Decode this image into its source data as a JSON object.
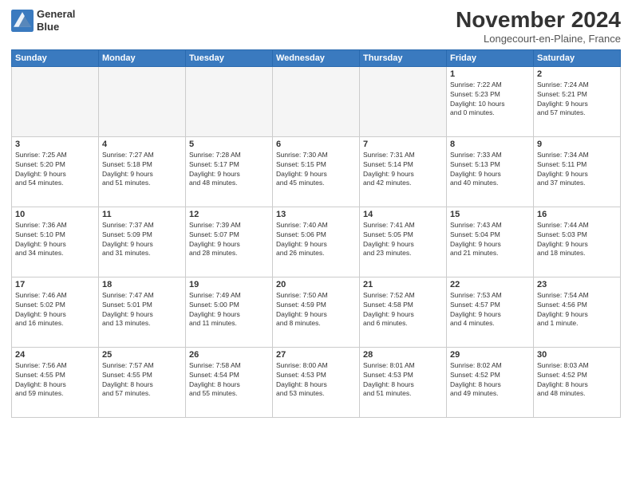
{
  "header": {
    "logo_line1": "General",
    "logo_line2": "Blue",
    "month_title": "November 2024",
    "location": "Longecourt-en-Plaine, France"
  },
  "weekdays": [
    "Sunday",
    "Monday",
    "Tuesday",
    "Wednesday",
    "Thursday",
    "Friday",
    "Saturday"
  ],
  "weeks": [
    [
      {
        "num": "",
        "info": ""
      },
      {
        "num": "",
        "info": ""
      },
      {
        "num": "",
        "info": ""
      },
      {
        "num": "",
        "info": ""
      },
      {
        "num": "",
        "info": ""
      },
      {
        "num": "1",
        "info": "Sunrise: 7:22 AM\nSunset: 5:23 PM\nDaylight: 10 hours\nand 0 minutes."
      },
      {
        "num": "2",
        "info": "Sunrise: 7:24 AM\nSunset: 5:21 PM\nDaylight: 9 hours\nand 57 minutes."
      }
    ],
    [
      {
        "num": "3",
        "info": "Sunrise: 7:25 AM\nSunset: 5:20 PM\nDaylight: 9 hours\nand 54 minutes."
      },
      {
        "num": "4",
        "info": "Sunrise: 7:27 AM\nSunset: 5:18 PM\nDaylight: 9 hours\nand 51 minutes."
      },
      {
        "num": "5",
        "info": "Sunrise: 7:28 AM\nSunset: 5:17 PM\nDaylight: 9 hours\nand 48 minutes."
      },
      {
        "num": "6",
        "info": "Sunrise: 7:30 AM\nSunset: 5:15 PM\nDaylight: 9 hours\nand 45 minutes."
      },
      {
        "num": "7",
        "info": "Sunrise: 7:31 AM\nSunset: 5:14 PM\nDaylight: 9 hours\nand 42 minutes."
      },
      {
        "num": "8",
        "info": "Sunrise: 7:33 AM\nSunset: 5:13 PM\nDaylight: 9 hours\nand 40 minutes."
      },
      {
        "num": "9",
        "info": "Sunrise: 7:34 AM\nSunset: 5:11 PM\nDaylight: 9 hours\nand 37 minutes."
      }
    ],
    [
      {
        "num": "10",
        "info": "Sunrise: 7:36 AM\nSunset: 5:10 PM\nDaylight: 9 hours\nand 34 minutes."
      },
      {
        "num": "11",
        "info": "Sunrise: 7:37 AM\nSunset: 5:09 PM\nDaylight: 9 hours\nand 31 minutes."
      },
      {
        "num": "12",
        "info": "Sunrise: 7:39 AM\nSunset: 5:07 PM\nDaylight: 9 hours\nand 28 minutes."
      },
      {
        "num": "13",
        "info": "Sunrise: 7:40 AM\nSunset: 5:06 PM\nDaylight: 9 hours\nand 26 minutes."
      },
      {
        "num": "14",
        "info": "Sunrise: 7:41 AM\nSunset: 5:05 PM\nDaylight: 9 hours\nand 23 minutes."
      },
      {
        "num": "15",
        "info": "Sunrise: 7:43 AM\nSunset: 5:04 PM\nDaylight: 9 hours\nand 21 minutes."
      },
      {
        "num": "16",
        "info": "Sunrise: 7:44 AM\nSunset: 5:03 PM\nDaylight: 9 hours\nand 18 minutes."
      }
    ],
    [
      {
        "num": "17",
        "info": "Sunrise: 7:46 AM\nSunset: 5:02 PM\nDaylight: 9 hours\nand 16 minutes."
      },
      {
        "num": "18",
        "info": "Sunrise: 7:47 AM\nSunset: 5:01 PM\nDaylight: 9 hours\nand 13 minutes."
      },
      {
        "num": "19",
        "info": "Sunrise: 7:49 AM\nSunset: 5:00 PM\nDaylight: 9 hours\nand 11 minutes."
      },
      {
        "num": "20",
        "info": "Sunrise: 7:50 AM\nSunset: 4:59 PM\nDaylight: 9 hours\nand 8 minutes."
      },
      {
        "num": "21",
        "info": "Sunrise: 7:52 AM\nSunset: 4:58 PM\nDaylight: 9 hours\nand 6 minutes."
      },
      {
        "num": "22",
        "info": "Sunrise: 7:53 AM\nSunset: 4:57 PM\nDaylight: 9 hours\nand 4 minutes."
      },
      {
        "num": "23",
        "info": "Sunrise: 7:54 AM\nSunset: 4:56 PM\nDaylight: 9 hours\nand 1 minute."
      }
    ],
    [
      {
        "num": "24",
        "info": "Sunrise: 7:56 AM\nSunset: 4:55 PM\nDaylight: 8 hours\nand 59 minutes."
      },
      {
        "num": "25",
        "info": "Sunrise: 7:57 AM\nSunset: 4:55 PM\nDaylight: 8 hours\nand 57 minutes."
      },
      {
        "num": "26",
        "info": "Sunrise: 7:58 AM\nSunset: 4:54 PM\nDaylight: 8 hours\nand 55 minutes."
      },
      {
        "num": "27",
        "info": "Sunrise: 8:00 AM\nSunset: 4:53 PM\nDaylight: 8 hours\nand 53 minutes."
      },
      {
        "num": "28",
        "info": "Sunrise: 8:01 AM\nSunset: 4:53 PM\nDaylight: 8 hours\nand 51 minutes."
      },
      {
        "num": "29",
        "info": "Sunrise: 8:02 AM\nSunset: 4:52 PM\nDaylight: 8 hours\nand 49 minutes."
      },
      {
        "num": "30",
        "info": "Sunrise: 8:03 AM\nSunset: 4:52 PM\nDaylight: 8 hours\nand 48 minutes."
      }
    ]
  ]
}
